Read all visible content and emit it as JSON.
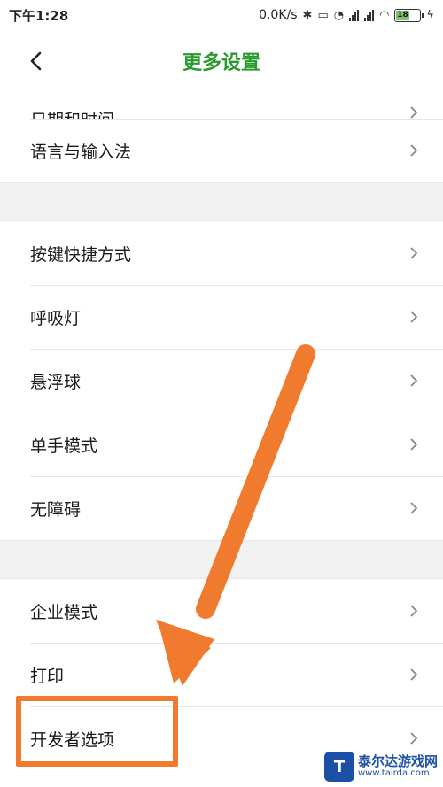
{
  "status_bar": {
    "time": "下午1:28",
    "net_speed": "0.0K/s",
    "battery": "18"
  },
  "header": {
    "title": "更多设置"
  },
  "groups": [
    {
      "items": [
        "日期和时间",
        "语言与输入法"
      ]
    },
    {
      "items": [
        "按键快捷方式",
        "呼吸灯",
        "悬浮球",
        "单手模式",
        "无障碍"
      ]
    },
    {
      "items": [
        "企业模式",
        "打印",
        "开发者选项"
      ]
    }
  ],
  "colors": {
    "title_green": "#2a9a2c",
    "annotation_orange": "#f07b2e"
  },
  "watermark": {
    "title": "泰尔达游戏网",
    "url": "www.tairda.com"
  }
}
